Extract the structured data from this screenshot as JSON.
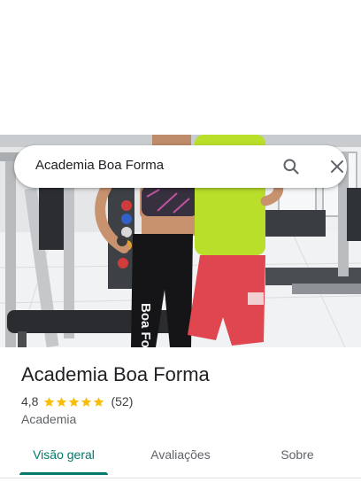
{
  "search": {
    "query": "Academia Boa Forma",
    "search_icon": "search-icon",
    "close_icon": "close-icon"
  },
  "place": {
    "name": "Academia Boa Forma",
    "rating": "4,8",
    "stars_value": 4.8,
    "review_count": "(52)",
    "category": "Academia"
  },
  "tabs": [
    {
      "label": "Visão geral",
      "active": true
    },
    {
      "label": "Avaliações",
      "active": false
    },
    {
      "label": "Sobre",
      "active": false
    }
  ],
  "photo": {
    "shirt_text": "Boa Forma"
  },
  "colors": {
    "accent": "#00796b",
    "star": "#fbbc04",
    "text_primary": "#202124",
    "text_secondary": "#5f6368"
  }
}
